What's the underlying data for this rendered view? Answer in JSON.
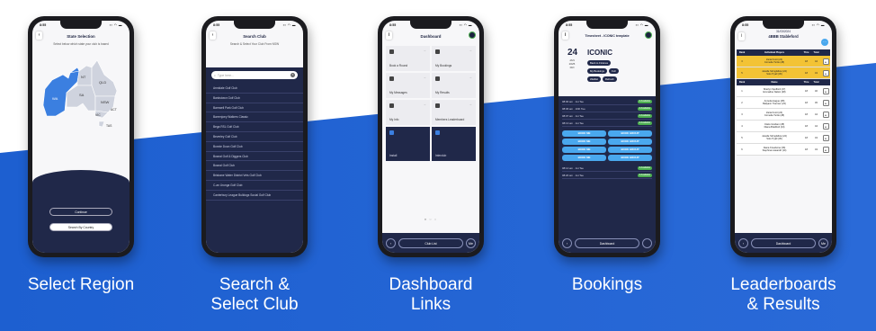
{
  "colors": {
    "brand_blue": "#2f6fd4",
    "navy": "#202849",
    "gold": "#f3c335",
    "button_blue": "#4aa8ee",
    "green": "#4caf50"
  },
  "captions": [
    {
      "line1": "Select Region",
      "line2": ""
    },
    {
      "line1": "Search &",
      "line2": "Select Club"
    },
    {
      "line1": "Dashboard",
      "line2": "Links"
    },
    {
      "line1": "Bookings",
      "line2": ""
    },
    {
      "line1": "Leaderboards",
      "line2": "& Results"
    }
  ],
  "status_time": "8:55",
  "phone1": {
    "title": "State Selection",
    "subtitle": "Select below which state your club is based",
    "regions": [
      "WA",
      "NT",
      "QLD",
      "SA",
      "NSW",
      "VIC",
      "ACT",
      "TAS"
    ],
    "continue_label": "Continue",
    "country_label": "Search By Country"
  },
  "phone2": {
    "title": "Search Club",
    "subtitle": "Search & Select Your Club From NSW",
    "search_placeholder": "Type here...",
    "clubs": [
      "Armidale Golf Club",
      "Bankstown Golf Club",
      "Barnwell Park Golf Club",
      "Barrenjoey Walkers Classic",
      "Bega RSL Golf Club",
      "Beverley Golf Club",
      "Bonnie Doon Golf Club",
      "Bowral Golf & Diggers Club",
      "Bowral Golf Club",
      "Brisbane Water District Vets Golf Club",
      "C-an Urunga Golf Club",
      "Canterbury League Bulldogs Social Golf Club"
    ]
  },
  "phone3": {
    "title": "Dashboard",
    "tiles": [
      {
        "label": "Book a Round",
        "dark": false
      },
      {
        "label": "My Bookings",
        "dark": false
      },
      {
        "label": "My Messages",
        "dark": false
      },
      {
        "label": "My Results",
        "dark": false
      },
      {
        "label": "My Info",
        "dark": false
      },
      {
        "label": "Members Leaderboard",
        "dark": false
      },
      {
        "label": "Install",
        "dark": true
      },
      {
        "label": "Interclub",
        "dark": true
      }
    ],
    "page_dots": "● ○ ○",
    "bottom_left": "‹",
    "bottom_center": "Club List",
    "bottom_right": "Me"
  },
  "phone4": {
    "title": "Timesheet - ICONIC template",
    "day": "24",
    "month": "JAN",
    "year": "2025",
    "weekday": "FRI",
    "club_name": "ICONIC",
    "tags_row1": [
      "Back to Fixtures"
    ],
    "tags_row2": [
      "My Bookings",
      "Full"
    ],
    "tags_row3": [
      "Waitlist",
      "Refresh"
    ],
    "tee_rows_top": [
      {
        "time": "08:00 am",
        "tee": "1st Tee",
        "status": "4 Available"
      },
      {
        "time": "08:06 am",
        "tee": "10th Tee",
        "status": "4 Available"
      },
      {
        "time": "08:07 am",
        "tee": "1st Tee",
        "status": "4 Available"
      },
      {
        "time": "08:13 am",
        "tee": "1st Tee",
        "status": "4 Available"
      }
    ],
    "book_me": "BOOK ME",
    "book_group": "BOOK GROUP",
    "tee_rows_bottom": [
      {
        "time": "08:14 am",
        "tee": "1st Tee",
        "status": "4 Available"
      },
      {
        "time": "08:20 am",
        "tee": "1st Tee",
        "status": "4 Available"
      }
    ],
    "bottom_left": "‹",
    "bottom_center": "Dashboard",
    "bottom_right": ""
  },
  "phone5": {
    "date": "31/03/2024",
    "title": "4BBB Stableford",
    "head1": [
      "Rank",
      "Individual Players",
      "Thru",
      "Total"
    ],
    "gold_rows": [
      {
        "rank": "3",
        "names": [
          "Zaria Knott (24)",
          "Cornelia Turtle (28)"
        ],
        "thru": "18",
        "total": "44"
      },
      {
        "rank": "5",
        "names": [
          "Janelle Stringfellow (24)",
          "Solo Tryall (36)"
        ],
        "thru": "18",
        "total": "43"
      }
    ],
    "head2": [
      "Rank",
      "Name",
      "Thru",
      "Total"
    ],
    "rows": [
      {
        "rank": "1",
        "names": [
          "Sharlyn Spofford (47)",
          "Emmaline Nation (28)"
        ],
        "thru": "18",
        "total": "46"
      },
      {
        "rank": "2",
        "names": [
          "Annetta Hague (28)",
          "Ballyann Tranmer (24)"
        ],
        "thru": "18",
        "total": "45"
      },
      {
        "rank": "3",
        "names": [
          "Zaria Knott (24)",
          "Cornelia Turtle (28)"
        ],
        "thru": "18",
        "total": "44"
      },
      {
        "rank": "4",
        "names": [
          "Claire Graham (28)",
          "Diana Bradford (24)"
        ],
        "thru": "18",
        "total": "44"
      },
      {
        "rank": "5",
        "names": [
          "Janelle Stringfellow (24)",
          "Solo Tryall (36)"
        ],
        "thru": "18",
        "total": "43"
      },
      {
        "rank": "6",
        "names": [
          "Alana Kneebone (36)",
          "Stephina Lissandri (14)"
        ],
        "thru": "18",
        "total": "43"
      }
    ],
    "bottom_left": "‹",
    "bottom_center": "Dashboard",
    "bottom_right": "Me"
  }
}
